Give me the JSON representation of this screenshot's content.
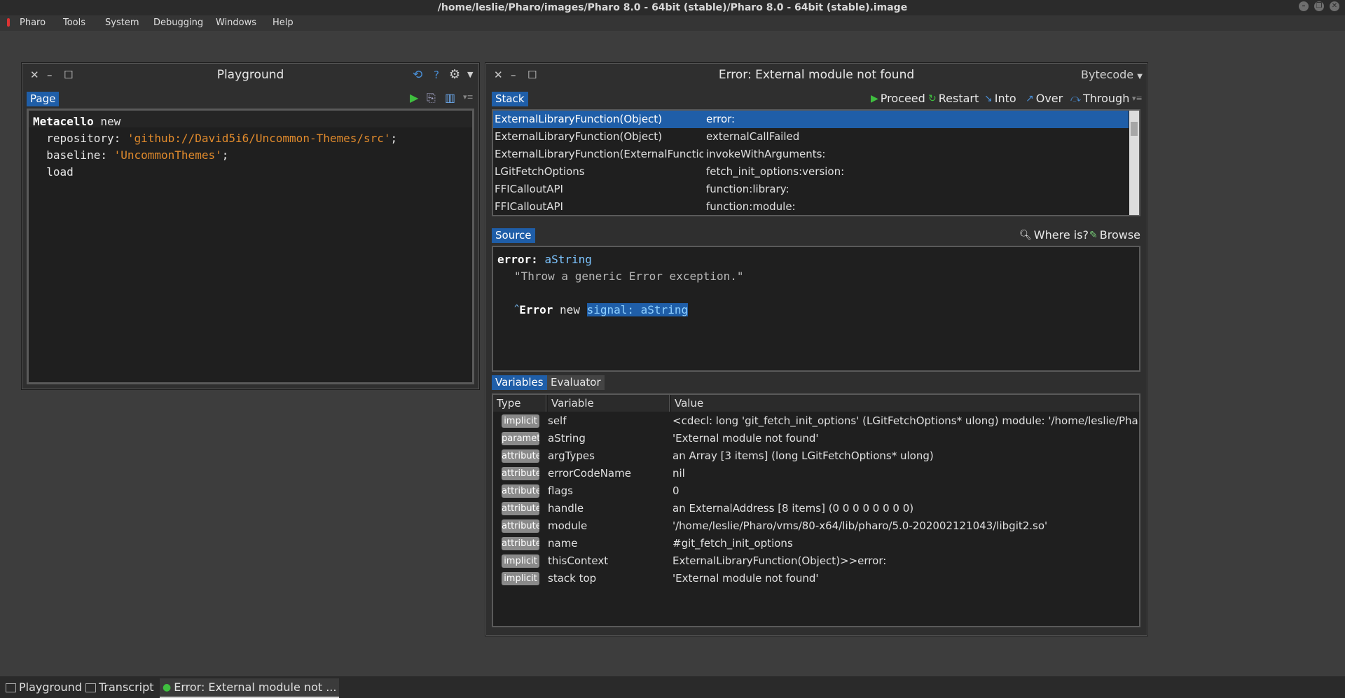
{
  "os": {
    "title": "/home/leslie/Pharo/images/Pharo 8.0 - 64bit (stable)/Pharo 8.0 - 64bit (stable).image",
    "controls": [
      "–",
      "❐",
      "✕"
    ]
  },
  "menubar": {
    "items": [
      "Pharo",
      "Tools",
      "System",
      "Debugging",
      "Windows",
      "Help"
    ]
  },
  "playground": {
    "title": "Playground",
    "tab": "Page",
    "code": {
      "line1_receiver": "Metacello",
      "line1_msg": " new",
      "line2_key": "  repository: ",
      "line2_str": "'github://David5i6/Uncommon-Themes/src'",
      "line2_end": ";",
      "line3_key": "  baseline: ",
      "line3_str": "'UncommonThemes'",
      "line3_end": ";",
      "line4": "  load"
    }
  },
  "debugger": {
    "title": "Error: External module not found",
    "mode": "Bytecode",
    "stack_tab": "Stack",
    "actions": {
      "proceed": "Proceed",
      "restart": "Restart",
      "into": "Into",
      "over": "Over",
      "through": "Through"
    },
    "stack": [
      {
        "cls": "ExternalLibraryFunction(Object)",
        "sel": "error:"
      },
      {
        "cls": "ExternalLibraryFunction(Object)",
        "sel": "externalCallFailed"
      },
      {
        "cls": "ExternalLibraryFunction(ExternalFunction",
        "sel": "invokeWithArguments:"
      },
      {
        "cls": "LGitFetchOptions",
        "sel": "fetch_init_options:version:"
      },
      {
        "cls": "FFICalloutAPI",
        "sel": "function:library:"
      },
      {
        "cls": "FFICalloutAPI",
        "sel": "function:module:"
      }
    ],
    "source_tab": "Source",
    "source_actions": {
      "where": "Where is?",
      "browse": "Browse"
    },
    "source": {
      "selector": "error:",
      "arg": "aString",
      "comment": "\"Throw a generic Error exception.\"",
      "caret": "^",
      "error_kw": "Error",
      "new_kw": "new",
      "highlight": "signal: aString"
    },
    "variables_tab": "Variables",
    "evaluator_tab": "Evaluator",
    "columns": {
      "type": "Type",
      "variable": "Variable",
      "value": "Value"
    },
    "variables": [
      {
        "type": "implicit",
        "name": "self",
        "value": "<cdecl: long 'git_fetch_init_options' (LGitFetchOptions* ulong) module: '/home/leslie/Pharo/v"
      },
      {
        "type": "parameter",
        "name": "aString",
        "value": "'External module not found'"
      },
      {
        "type": "attribute",
        "name": "argTypes",
        "value": "an Array [3 items] (long LGitFetchOptions* ulong)"
      },
      {
        "type": "attribute",
        "name": "errorCodeName",
        "value": "nil"
      },
      {
        "type": "attribute",
        "name": "flags",
        "value": "0"
      },
      {
        "type": "attribute",
        "name": "handle",
        "value": "an ExternalAddress [8 items] (0 0 0 0 0 0 0 0)"
      },
      {
        "type": "attribute",
        "name": "module",
        "value": "'/home/leslie/Pharo/vms/80-x64/lib/pharo/5.0-202002121043/libgit2.so'"
      },
      {
        "type": "attribute",
        "name": "name",
        "value": "#git_fetch_init_options"
      },
      {
        "type": "implicit",
        "name": "thisContext",
        "value": "ExternalLibraryFunction(Object)>>error:"
      },
      {
        "type": "implicit",
        "name": "stack top",
        "value": "'External module not found'"
      }
    ]
  },
  "taskbar": {
    "items": [
      "Playground",
      "Transcript",
      "Error: External module not ..."
    ]
  },
  "colors": {
    "accent": "#1f5ea8",
    "string": "#e08a2c",
    "background": "#3d3d3d"
  }
}
